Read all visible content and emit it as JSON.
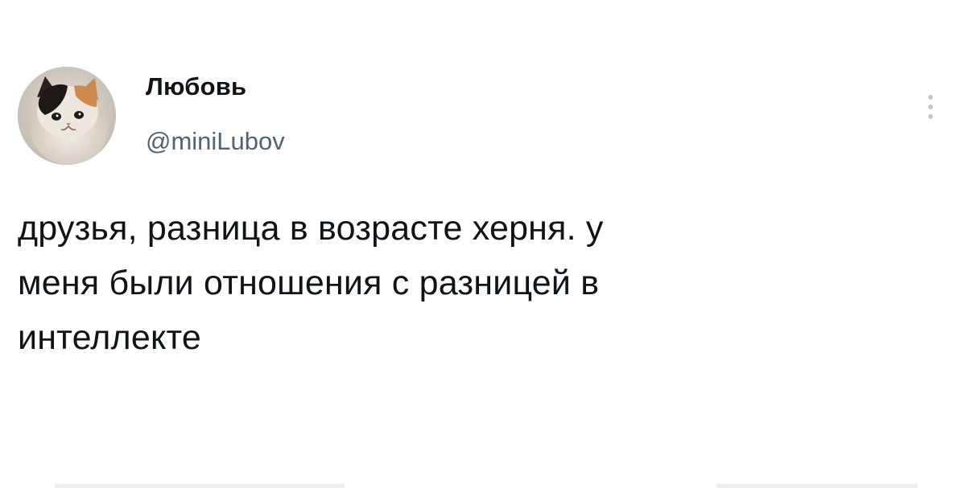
{
  "tweet": {
    "author": {
      "display_name": "Любовь",
      "handle": "@miniLubov",
      "avatar_icon": "kitten-avatar"
    },
    "more_icon": "more-vertical-icon",
    "text_lines": [
      "друзья, разница в возрасте херня. у",
      "меня были отношения с разницей в",
      "интеллекте"
    ]
  },
  "colors": {
    "text_primary": "#0f1419",
    "text_secondary": "#536471",
    "background": "#ffffff"
  }
}
